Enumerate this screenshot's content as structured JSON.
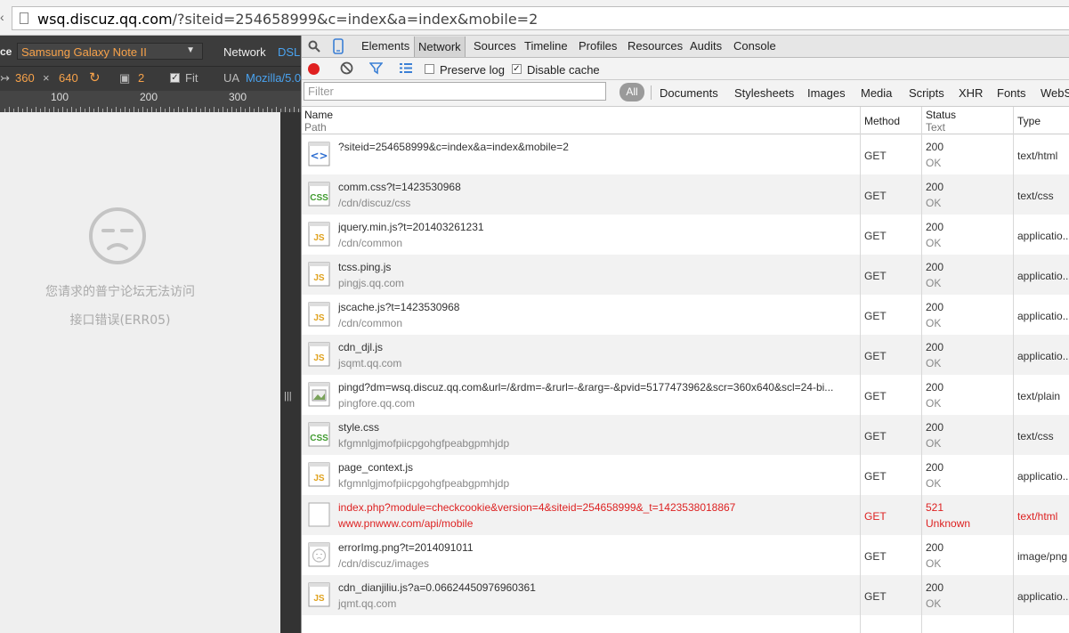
{
  "address_bar": {
    "url_host": "wsq.discuz.qq.com",
    "url_rest": "/?siteid=254658999&c=index&a=index&mobile=2"
  },
  "emulation": {
    "device_label_prefix": "ce",
    "device_name": "Samsung Galaxy Note II",
    "network_label": "Network",
    "network_value": "DSL",
    "width": "360",
    "times": "×",
    "height": "640",
    "scale": "2",
    "fit_label": "Fit",
    "ua_label": "UA",
    "ua_value": "Mozilla/5.0",
    "ruler_ticks": [
      "100",
      "200",
      "300"
    ]
  },
  "page": {
    "message": "您请求的普宁论坛无法访问",
    "error": "接口错误(ERR05)"
  },
  "devtools": {
    "tabs": [
      "Elements",
      "Network",
      "Sources",
      "Timeline",
      "Profiles",
      "Resources",
      "Audits",
      "Console"
    ],
    "active_tab": "Network",
    "toolbar": {
      "preserve_log": "Preserve log",
      "disable_cache": "Disable cache"
    },
    "filter": {
      "placeholder": "Filter",
      "all": "All",
      "types": [
        "Documents",
        "Stylesheets",
        "Images",
        "Media",
        "Scripts",
        "XHR",
        "Fonts",
        "WebS"
      ]
    },
    "columns": {
      "name": "Name",
      "path": "Path",
      "method": "Method",
      "status": "Status",
      "text": "Text",
      "type": "Type"
    },
    "requests": [
      {
        "name": "?siteid=254658999&c=index&a=index&mobile=2",
        "path": "",
        "method": "GET",
        "status": "200",
        "text": "OK",
        "type": "text/html",
        "icon": "html-document-icon",
        "error": false
      },
      {
        "name": "comm.css?t=1423530968",
        "path": "/cdn/discuz/css",
        "method": "GET",
        "status": "200",
        "text": "OK",
        "type": "text/css",
        "icon": "css-file-icon",
        "error": false
      },
      {
        "name": "jquery.min.js?t=201403261231",
        "path": "/cdn/common",
        "method": "GET",
        "status": "200",
        "text": "OK",
        "type": "applicatio...",
        "icon": "js-file-icon",
        "error": false
      },
      {
        "name": "tcss.ping.js",
        "path": "pingjs.qq.com",
        "method": "GET",
        "status": "200",
        "text": "OK",
        "type": "applicatio...",
        "icon": "js-file-icon",
        "error": false
      },
      {
        "name": "jscache.js?t=1423530968",
        "path": "/cdn/common",
        "method": "GET",
        "status": "200",
        "text": "OK",
        "type": "applicatio...",
        "icon": "js-file-icon",
        "error": false
      },
      {
        "name": "cdn_djl.js",
        "path": "jsqmt.qq.com",
        "method": "GET",
        "status": "200",
        "text": "OK",
        "type": "applicatio...",
        "icon": "js-file-icon",
        "error": false
      },
      {
        "name": "pingd?dm=wsq.discuz.qq.com&url=/&rdm=-&rurl=-&rarg=-&pvid=5177473962&scr=360x640&scl=24-bi...",
        "path": "pingfore.qq.com",
        "method": "GET",
        "status": "200",
        "text": "OK",
        "type": "text/plain",
        "icon": "image-file-icon",
        "error": false
      },
      {
        "name": "style.css",
        "path": "kfgmnlgjmofpiicpgohgfpeabgpmhjdp",
        "method": "GET",
        "status": "200",
        "text": "OK",
        "type": "text/css",
        "icon": "css-file-icon",
        "error": false
      },
      {
        "name": "page_context.js",
        "path": "kfgmnlgjmofpiicpgohgfpeabgpmhjdp",
        "method": "GET",
        "status": "200",
        "text": "OK",
        "type": "applicatio...",
        "icon": "js-file-icon",
        "error": false
      },
      {
        "name": "index.php?module=checkcookie&version=4&siteid=254658999&_t=1423538018867",
        "path": "www.pnwww.com/api/mobile",
        "method": "GET",
        "status": "521",
        "text": "Unknown",
        "type": "text/html",
        "icon": "blank-file-icon",
        "error": true
      },
      {
        "name": "errorImg.png?t=2014091011",
        "path": "/cdn/discuz/images",
        "method": "GET",
        "status": "200",
        "text": "OK",
        "type": "image/png",
        "icon": "image-thumbnail-icon",
        "error": false
      },
      {
        "name": "cdn_dianjiliu.js?a=0.06624450976960361",
        "path": "jqmt.qq.com",
        "method": "GET",
        "status": "200",
        "text": "OK",
        "type": "applicatio...",
        "icon": "js-file-icon",
        "error": false
      }
    ]
  },
  "colors": {
    "error": "#dd2222",
    "accent_orange": "#f7a24a",
    "accent_blue": "#4aa3f0",
    "record": "#e02020"
  }
}
